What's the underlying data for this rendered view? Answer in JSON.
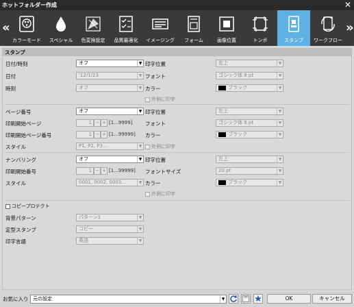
{
  "window": {
    "title": "ホットフォルダー作成",
    "close": "✕"
  },
  "toolbar": {
    "left_arrow": "«",
    "right_arrow": "»",
    "tabs": [
      {
        "label": "カラーモード",
        "icon": "color-mode-icon"
      },
      {
        "label": "スペシャル",
        "icon": "special-drop-icon"
      },
      {
        "label": "色変換設定",
        "icon": "color-conversion-icon"
      },
      {
        "label": "品質最適化",
        "icon": "quality-checklist-icon"
      },
      {
        "label": "イメージング",
        "icon": "imaging-icon"
      },
      {
        "label": "フォーム",
        "icon": "form-icon"
      },
      {
        "label": "画像位置",
        "icon": "image-position-icon"
      },
      {
        "label": "トンボ",
        "icon": "crop-marks-icon"
      },
      {
        "label": "スタンプ",
        "icon": "stamp-icon",
        "selected": true
      },
      {
        "label": "ワークフロー",
        "icon": "workflow-icon"
      }
    ]
  },
  "section_title": "スタンプ",
  "datetime": {
    "label": "日付/時刻",
    "value": "オフ",
    "date_label": "日付",
    "date_value": "'12/1/23",
    "time_label": "時刻",
    "time_value": "オフ",
    "pos_label": "印字位置",
    "pos_value": "左上",
    "font_label": "フォント",
    "font_value": "ゴシック体 8 pt",
    "color_label": "カラー",
    "color_value": "ブラック",
    "outside_label": "外側に印字"
  },
  "page_number": {
    "label": "ページ番号",
    "value": "オフ",
    "start_label": "印刷開始ページ",
    "start_value": "1",
    "start_range": "[1...9999]",
    "start_num_label": "印刷開始ページ番号",
    "start_num_value": "1",
    "start_num_range": "[1...99999]",
    "style_label": "スタイル",
    "style_value": "P1, P2, P3...",
    "pos_label": "印字位置",
    "pos_value": "左上",
    "font_label": "フォント",
    "font_value": "ゴシック体 8 pt",
    "color_label": "カラー",
    "color_value": "ブラック",
    "outside_label": "外側に印字"
  },
  "numbering": {
    "label": "ナンバリング",
    "value": "オフ",
    "start_label": "印刷開始番号",
    "start_value": "1",
    "start_range": "[1...99999]",
    "style_label": "スタイル",
    "style_value": "0001, 0002, 0003...",
    "pos_label": "印字位置",
    "pos_value": "左上",
    "size_label": "フォントサイズ",
    "size_value": "20 pt",
    "color_label": "カラー",
    "color_value": "ブラック",
    "outside_label": "外側に印字"
  },
  "copy_protect": {
    "label": "コピープロテクト",
    "bg_label": "背景パターン",
    "bg_value": "パターン1",
    "stamp_label": "定型スタンプ",
    "stamp_value": "コピー",
    "lang_label": "印字言語",
    "lang_value": "英語"
  },
  "footer": {
    "fav_label": "お気に入り",
    "fav_value": "元の設定",
    "ok": "OK",
    "cancel": "キャンセル"
  },
  "colors": {
    "accent": "#5fb1e3",
    "toolbar": "#3a3a3a",
    "titlebar": "#2a2a2a"
  }
}
